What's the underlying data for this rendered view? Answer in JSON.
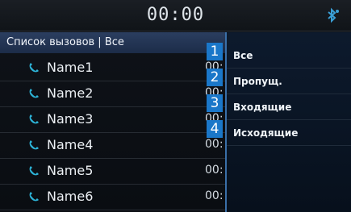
{
  "status_bar": {
    "time": "00:00",
    "icon": "bluetooth-icon"
  },
  "call_list": {
    "header": "Список вызовов | Все",
    "rows": [
      {
        "name": "Name1",
        "time": "00:"
      },
      {
        "name": "Name2",
        "time": "00:"
      },
      {
        "name": "Name3",
        "time": "00:"
      },
      {
        "name": "Name4",
        "time": "00:"
      },
      {
        "name": "Name5",
        "time": "00:"
      },
      {
        "name": "Name6",
        "time": "00:"
      }
    ],
    "row_icon": "phone-icon"
  },
  "filter_menu": {
    "options": [
      {
        "number": "1",
        "label": "Все"
      },
      {
        "number": "2",
        "label": "Пропущ."
      },
      {
        "number": "3",
        "label": "Входящие"
      },
      {
        "number": "4",
        "label": "Исходящие"
      }
    ]
  },
  "colors": {
    "accent": "#1a77c9",
    "header_bg": "#2b3e60",
    "phone_icon": "#2db4d8"
  }
}
